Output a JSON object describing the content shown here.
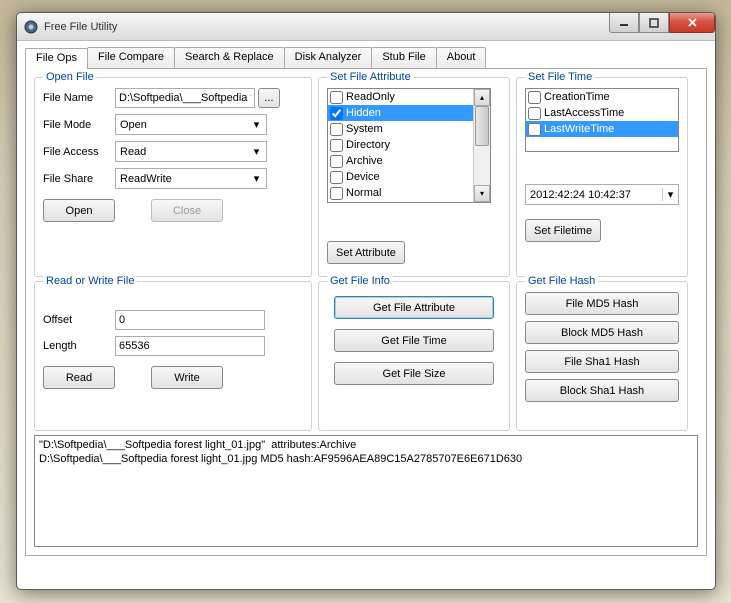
{
  "window": {
    "title": "Free File Utility"
  },
  "tabs": [
    "File Ops",
    "File Compare",
    "Search & Replace",
    "Disk Analyzer",
    "Stub File",
    "About"
  ],
  "open": {
    "legend": "Open File",
    "fileName_label": "File Name",
    "fileName_value": "D:\\Softpedia\\___Softpedia fo",
    "fileMode_label": "File Mode",
    "fileMode_value": "Open",
    "fileAccess_label": "File Access",
    "fileAccess_value": "Read",
    "fileShare_label": "File Share",
    "fileShare_value": "ReadWrite",
    "open_btn": "Open",
    "close_btn": "Close"
  },
  "attr": {
    "legend": "Set File Attribute",
    "items": [
      "ReadOnly",
      "Hidden",
      "System",
      "Directory",
      "Archive",
      "Device",
      "Normal"
    ],
    "checked_index": 1,
    "selected_index": 1,
    "set_btn": "Set Attribute"
  },
  "time": {
    "legend": "Set File Time",
    "items": [
      "CreationTime",
      "LastAccessTime",
      "LastWriteTime"
    ],
    "selected_index": 2,
    "datetime_value": "2012:42:24  10:42:37",
    "set_btn": "Set Filetime"
  },
  "rw": {
    "legend": "Read or Write File",
    "offset_label": "Offset",
    "offset_value": "0",
    "length_label": "Length",
    "length_value": "65536",
    "read_btn": "Read",
    "write_btn": "Write"
  },
  "info": {
    "legend": "Get File Info",
    "get_attr_btn": "Get File Attribute",
    "get_time_btn": "Get File Time",
    "get_size_btn": "Get File Size"
  },
  "hash": {
    "legend": "Get File Hash",
    "file_md5_btn": "File MD5 Hash",
    "block_md5_btn": "Block MD5 Hash",
    "file_sha1_btn": "File Sha1 Hash",
    "block_sha1_btn": "Block Sha1 Hash"
  },
  "output": "\"D:\\Softpedia\\___Softpedia forest light_01.jpg\"  attributes:Archive\nD:\\Softpedia\\___Softpedia forest light_01.jpg MD5 hash:AF9596AEA89C15A2785707E6E671D630"
}
